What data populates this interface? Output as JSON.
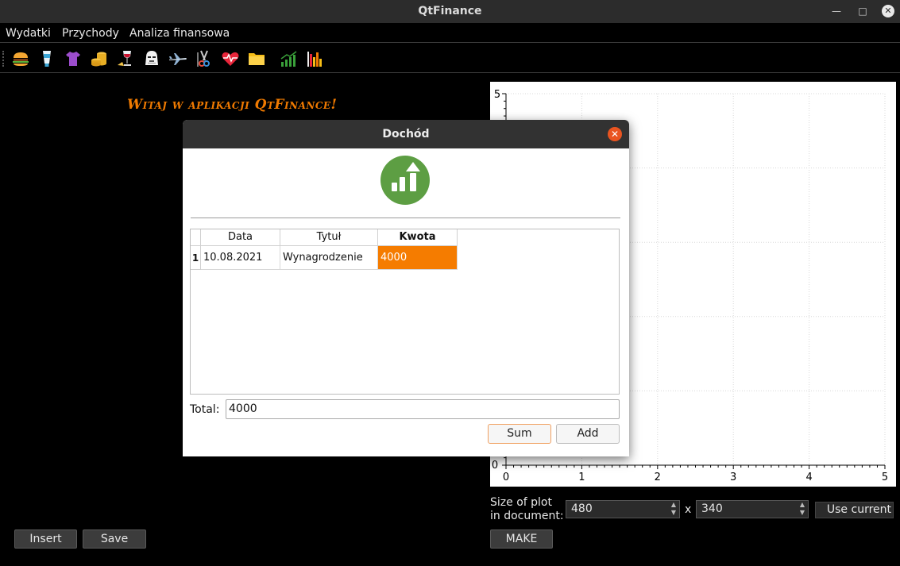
{
  "window": {
    "title": "QtFinance",
    "minimize": "—",
    "maximize": "□",
    "close": "✕"
  },
  "menu": [
    "Wydatki",
    "Przychody",
    "Analiza finansowa"
  ],
  "toolbar_icons": [
    "burger-icon",
    "toothpaste-icon",
    "tshirt-icon",
    "coins-icon",
    "wine-icon",
    "stormtrooper-icon",
    "airplane-icon",
    "scissors-icon",
    "heartbeat-icon",
    "folder-icon",
    "growth-chart-icon",
    "bar-chart-icon"
  ],
  "welcome": "Witaj w aplikacji QtFinance!",
  "plot": {
    "xlim": [
      0,
      5
    ],
    "ylim": [
      0,
      5
    ],
    "x_ticks": [
      "0",
      "1",
      "2",
      "3",
      "4",
      "5"
    ],
    "y_ticks": [
      "0",
      "5"
    ],
    "grid": true
  },
  "left_buttons": {
    "insert": "Insert",
    "save": "Save"
  },
  "plot_controls": {
    "size_label_1": "Size of plot",
    "size_label_2": "in document:",
    "width": "480",
    "times": "x",
    "height": "340",
    "use_current": "Use current",
    "make": "MAKE"
  },
  "dialog": {
    "title": "Dochód",
    "close": "✕",
    "columns": [
      "Data",
      "Tytuł",
      "Kwota"
    ],
    "rows": [
      {
        "index": "1",
        "data": "10.08.2021",
        "tytul": "Wynagrodzenie",
        "kwota": "4000"
      }
    ],
    "total_label": "Total:",
    "total_value": "4000",
    "sum_label": "Sum",
    "add_label": "Add",
    "accent": "#f57c00"
  }
}
